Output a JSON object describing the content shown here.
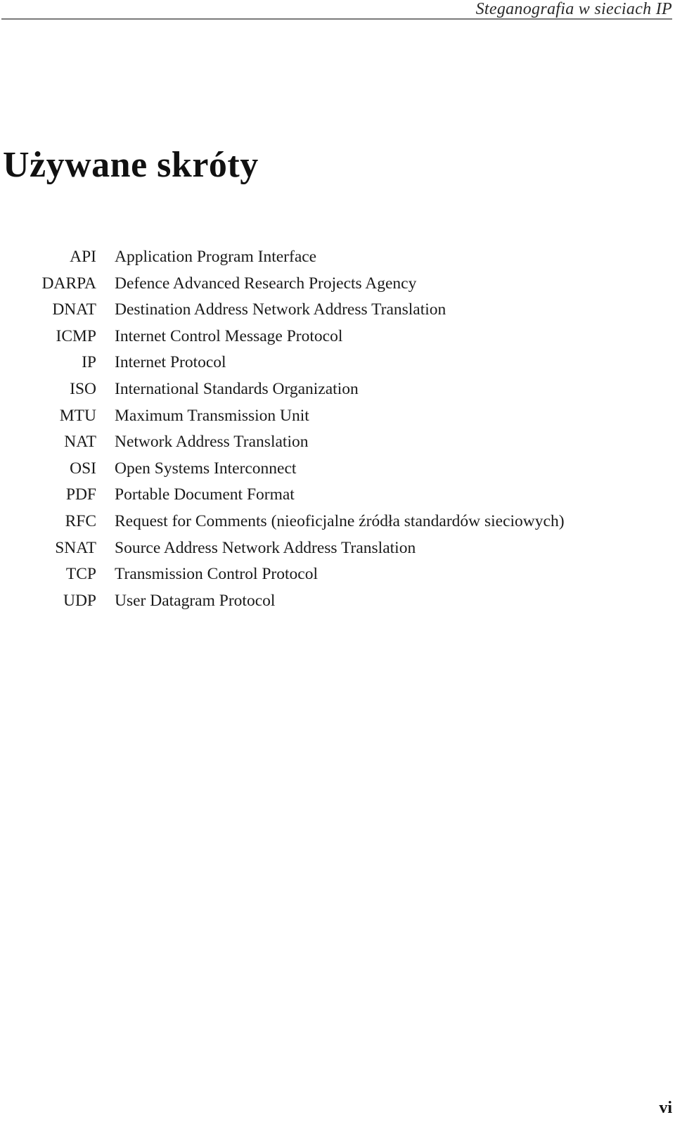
{
  "header": {
    "running_title": "Steganografia w sieciach IP"
  },
  "chapter": {
    "title": "Używane skróty"
  },
  "abbreviations": [
    {
      "term": "API",
      "definition": "Application Program Interface"
    },
    {
      "term": "DARPA",
      "definition": "Defence Advanced Research Projects Agency"
    },
    {
      "term": "DNAT",
      "definition": "Destination Address Network Address Translation"
    },
    {
      "term": "ICMP",
      "definition": "Internet Control Message Protocol"
    },
    {
      "term": "IP",
      "definition": "Internet Protocol"
    },
    {
      "term": "ISO",
      "definition": "International Standards Organization"
    },
    {
      "term": "MTU",
      "definition": "Maximum Transmission Unit"
    },
    {
      "term": "NAT",
      "definition": "Network Address Translation"
    },
    {
      "term": "OSI",
      "definition": "Open Systems Interconnect"
    },
    {
      "term": "PDF",
      "definition": "Portable Document Format"
    },
    {
      "term": "RFC",
      "definition": "Request for Comments (nieoficjalne źródła standardów sieciowych)"
    },
    {
      "term": "SNAT",
      "definition": "Source Address Network Address Translation"
    },
    {
      "term": "TCP",
      "definition": "Transmission Control Protocol"
    },
    {
      "term": "UDP",
      "definition": "User Datagram Protocol"
    }
  ],
  "footer": {
    "page_number": "vi"
  }
}
